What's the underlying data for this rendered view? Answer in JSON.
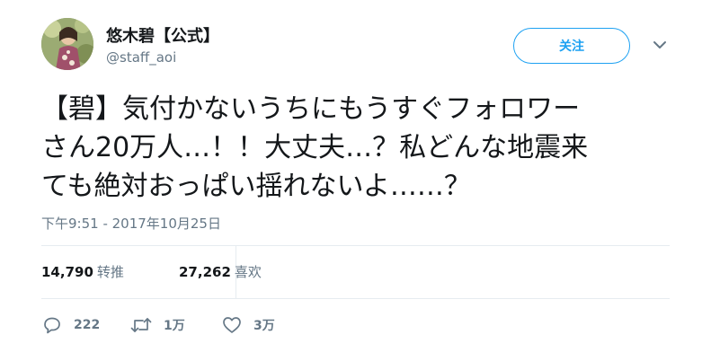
{
  "header": {
    "display_name": "悠木碧【公式】",
    "handle": "@staff_aoi",
    "follow_label": "关注",
    "more_icon": "chevron-down-icon",
    "avatar_icon": "avatar"
  },
  "tweet": {
    "lines": [
      "【碧】気付かないうちにもうすぐフォロワー",
      "さん20万人…！！大丈夫…？私どんな地震来",
      "ても絶対おっぱい揺れないよ……？"
    ],
    "timestamp": "下午9:51 - 2017年10月25日"
  },
  "stats": {
    "retweets_count": "14,790",
    "retweets_label": "转推",
    "likes_count": "27,262",
    "likes_label": "喜欢"
  },
  "actions": {
    "reply_count": "222",
    "retweet_count": "1万",
    "like_count": "3万"
  },
  "colors": {
    "accent": "#1da1f2",
    "secondary_text": "#657786",
    "divider": "#e6ecf0"
  }
}
